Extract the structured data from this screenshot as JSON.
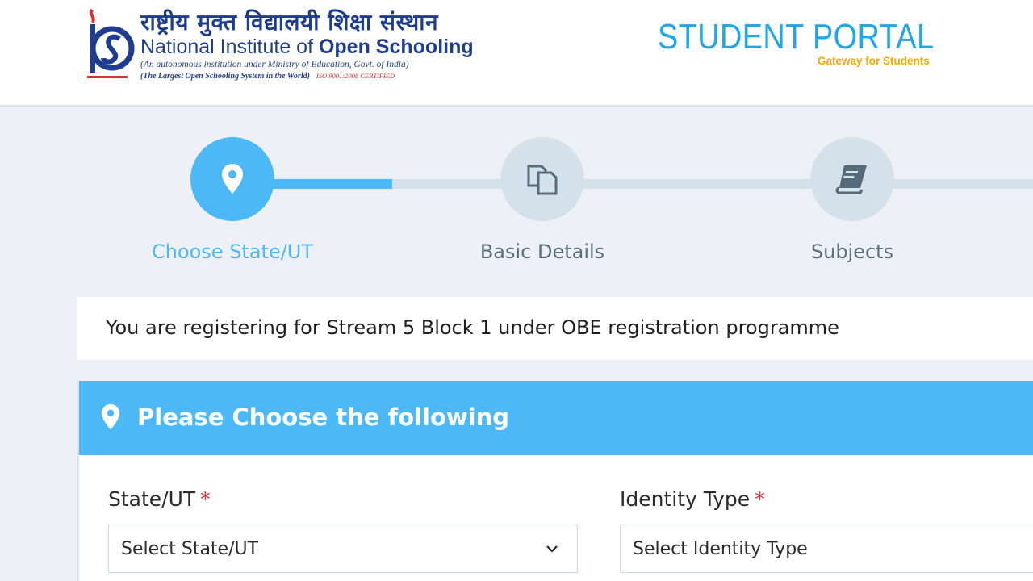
{
  "header": {
    "hindi_name": "राष्ट्रीय मुक्त विद्यालयी शिक्षा संस्थान",
    "name_regular": "National Institute of ",
    "name_bold": "Open Schooling",
    "tagline": "(An autonomous institution under Ministry of Education, Govt. of India)",
    "tagline2": "(The Largest Open Schooling System in the World)",
    "iso": "ISO 9001:2008 CERTIFIED",
    "portal_title": "STUDENT PORTAL",
    "portal_subtitle": "Gateway for Students"
  },
  "stepper": {
    "steps": [
      {
        "label": "Choose State/UT",
        "icon": "location-pin-icon",
        "active": true
      },
      {
        "label": "Basic Details",
        "icon": "documents-icon",
        "active": false
      },
      {
        "label": "Subjects",
        "icon": "book-icon",
        "active": false
      }
    ],
    "progress_fraction": 0.2
  },
  "notice": {
    "text": "You are registering for Stream 5 Block 1 under OBE registration programme"
  },
  "form": {
    "heading": "Please Choose the following",
    "state": {
      "label": "State/UT",
      "required_mark": "*",
      "value": "Select State/UT"
    },
    "identity": {
      "label": "Identity Type",
      "required_mark": "*",
      "value": "Select Identity Type"
    }
  },
  "colors": {
    "accent": "#4db8f6",
    "brand_blue": "#1f3d8f",
    "portal_blue": "#1ea7e9",
    "gold": "#f2a900",
    "required": "#d8302f",
    "inactive": "#d5e1ea"
  }
}
